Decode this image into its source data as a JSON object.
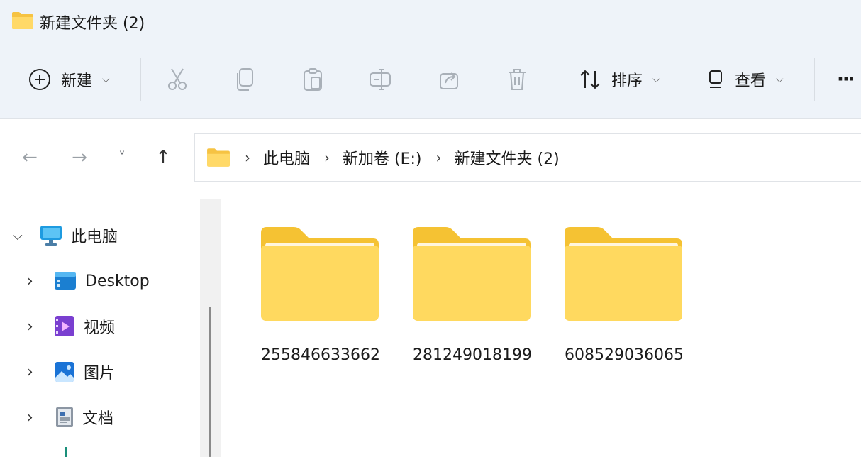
{
  "window": {
    "title": "新建文件夹 (2)",
    "title_icon": "folder-icon"
  },
  "toolbar": {
    "new_label": "新建",
    "sort_label": "排序",
    "view_label": "查看",
    "more_label": "···"
  },
  "nav": {
    "back": "←",
    "forward": "→",
    "recent": "˅",
    "up": "↑"
  },
  "breadcrumb": [
    "此电脑",
    "新加卷 (E:)",
    "新建文件夹 (2)"
  ],
  "sidebar": {
    "items": [
      {
        "label": "此电脑",
        "icon": "monitor-icon"
      },
      {
        "label": "Desktop",
        "icon": "desktop-icon"
      },
      {
        "label": "视频",
        "icon": "video-icon"
      },
      {
        "label": "图片",
        "icon": "pictures-icon"
      },
      {
        "label": "文档",
        "icon": "document-icon"
      }
    ]
  },
  "files": [
    {
      "name": "255846633662",
      "type": "folder"
    },
    {
      "name": "281249018199",
      "type": "folder"
    },
    {
      "name": "608529036065",
      "type": "folder"
    }
  ],
  "colors": {
    "chrome": "#eef3f9",
    "folder": "#ffd75e",
    "accent": "#0067c0"
  }
}
